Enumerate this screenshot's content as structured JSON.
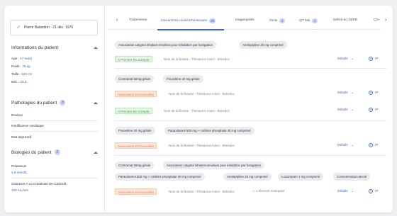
{
  "patient": {
    "gender_symbol": "♂",
    "card_label": "Pierre Balandrin - 21 déc. 1976"
  },
  "patient_info": {
    "title": "Informations du patient",
    "age_label": "Age : ",
    "age_value": "47 an(s)",
    "weight_label": "Poids : ",
    "weight_value": "78 kg",
    "height_label": "Taille : ",
    "height_value": "183 cm",
    "bmi_label": "IMC : ",
    "bmi_value": "23.3"
  },
  "pathologies": {
    "title": "Pathologies du patient",
    "count": "3",
    "items": [
      "Douleur",
      "Insuffisance cardiaque",
      "Etat depressif"
    ]
  },
  "biologies": {
    "title": "Biologies du patient",
    "count": "2",
    "items": [
      {
        "name": "Potassium",
        "value": "4.9 mmol/L"
      },
      {
        "name": "Clairance A La Créatinine De Cockroft",
        "value": "105 mL/min"
      }
    ]
  },
  "tabs": [
    {
      "label": "Traitements",
      "badge": ""
    },
    {
      "label": "Interactions médicamenteuses",
      "badge": "28"
    },
    {
      "label": "Inappropriés",
      "badge": ""
    },
    {
      "label": "Omis",
      "badge": "4"
    },
    {
      "label": "QT risk",
      "badge": "2"
    },
    {
      "label": "Déficit en G6PD",
      "badge": ""
    },
    {
      "label": "Che",
      "badge": ""
    }
  ],
  "actions": {
    "details_label": "Détails",
    "ip_label": "IP"
  },
  "interactions": [
    {
      "drugs": [
        "Association calyptol inhalant émulsion pour inhalation par fumigation",
        "Amitriptyline 25 mg comprimé"
      ],
      "findings": [
        {
          "level": "A Prendre En Compte",
          "source": "Nom de la librairie : Thésaurus Ansm - Bimedoc",
          "warning": ""
        }
      ]
    },
    {
      "drugs": [
        "Contramal 50mg gélule",
        "Fluoxétine 20 mg gélule"
      ],
      "findings": [
        {
          "level": "Association Déconseillée",
          "source": "Nom de la librairie : Thésaurus Ansm - Bimedoc",
          "warning": ""
        },
        {
          "level": "A Prendre En Compte",
          "source": "Nom de la librairie : Thésaurus Ansm - Bimedoc",
          "warning": ""
        }
      ]
    },
    {
      "drugs": [
        "Fluoxétine 20 mg gélule",
        "Paracétamol 500 mg + codéine phosphate 30 mg comprimé"
      ],
      "findings": [
        {
          "level": "Association Déconseillée",
          "source": "Nom de la librairie : Thésaurus Ansm - Bimedoc",
          "warning": ""
        }
      ]
    },
    {
      "drugs": [
        "Contramal 50mg gélule",
        "Association calyptol inhalant émulsion pour inhalation par fumigation",
        "Paracétamol 500 mg + codéine phosphate 30 mg comprimé",
        "Amitriptyline 25 mg comprimé",
        "Loxazépam 1 mg comprimé",
        "Consommation alcool"
      ],
      "findings": [
        {
          "level": "Association Déconseillée",
          "source": "Nom de la librairie : Thésaurus Ansm - Bimedoc",
          "warning": "1 élément manquant"
        }
      ]
    }
  ],
  "colors": {
    "accent": "#3d63c9",
    "green_tag": "#49a849",
    "orange_tag": "#e8804e",
    "chip_bg": "#e9ebee"
  }
}
